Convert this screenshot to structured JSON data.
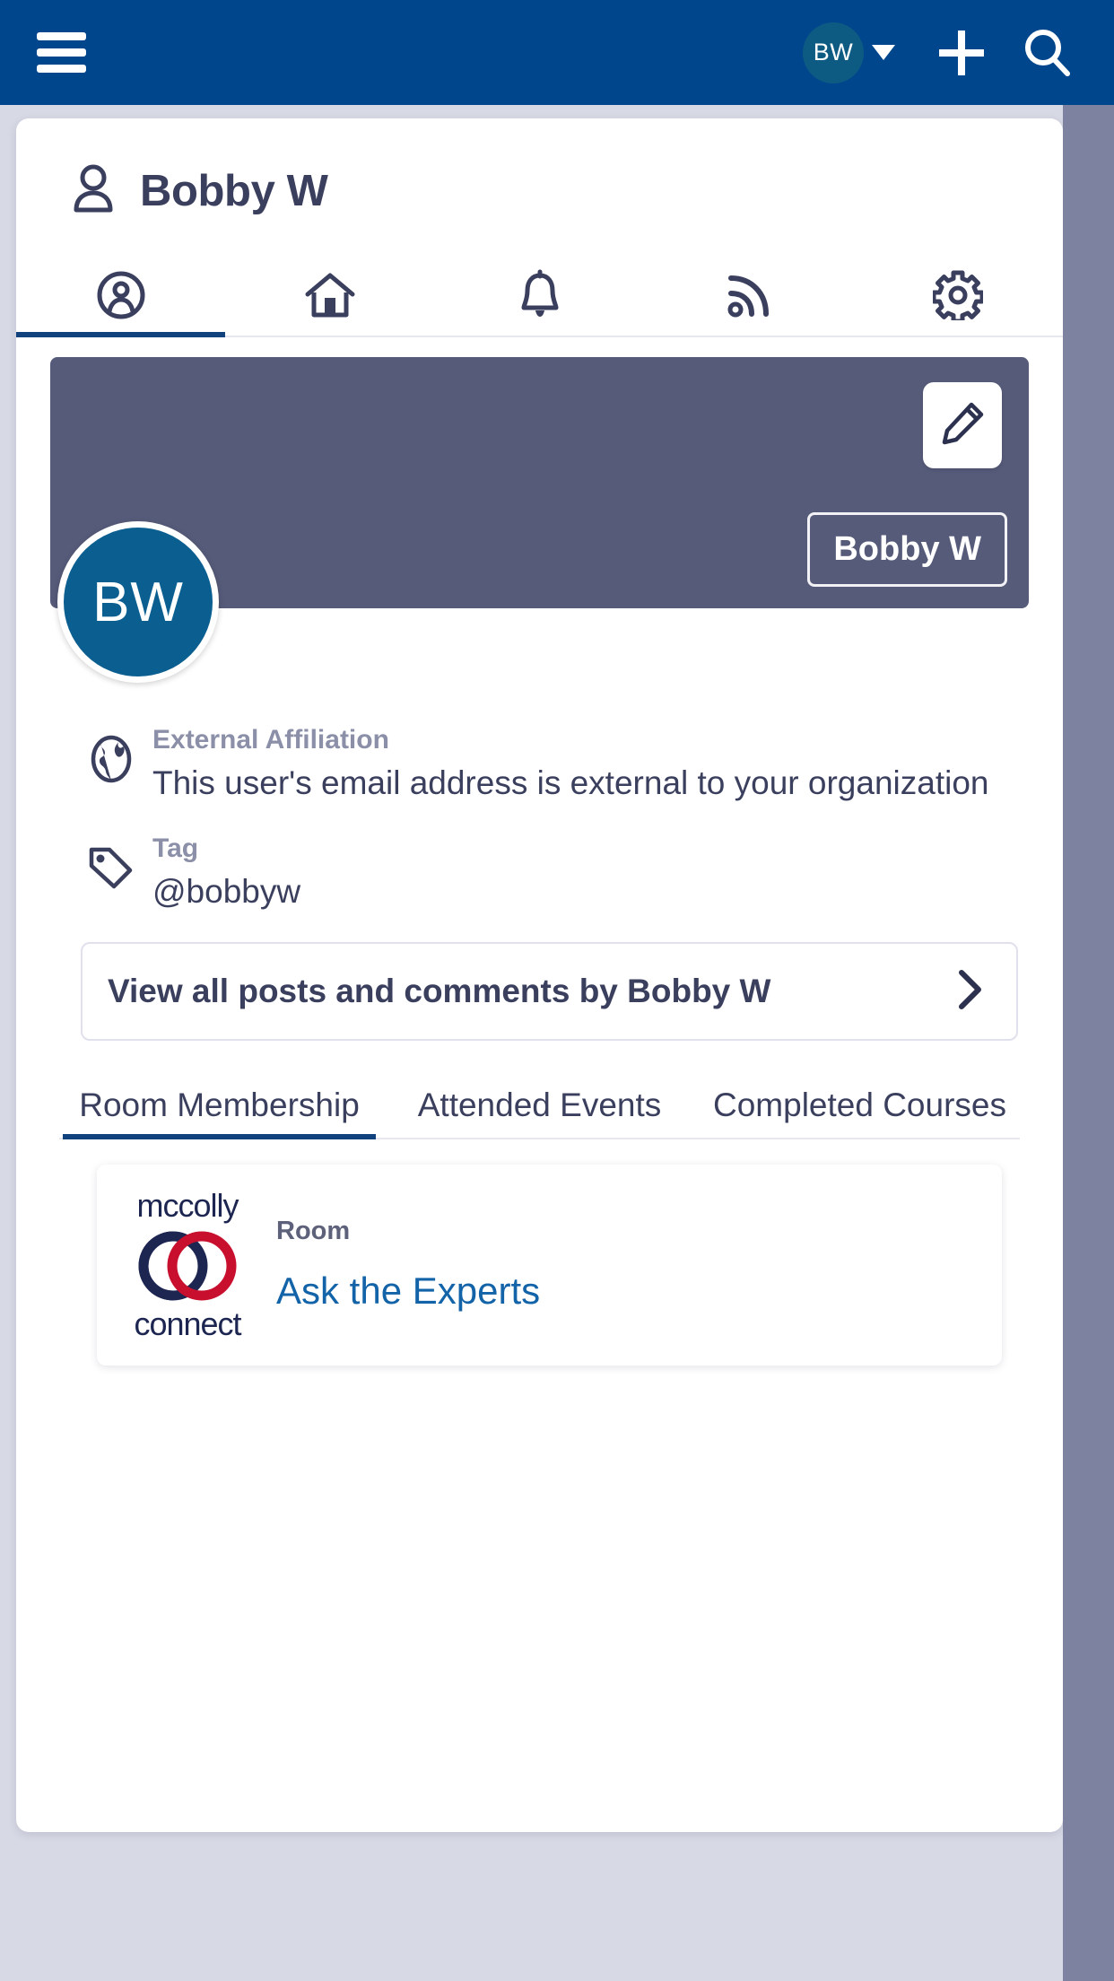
{
  "topbar": {
    "menu_icon": "hamburger-menu-icon",
    "avatar_initials": "BW",
    "caret_icon": "chevron-down-icon",
    "add_icon": "plus-icon",
    "search_icon": "search-icon",
    "background_color": "#00468c",
    "avatar_color": "#0d5b82"
  },
  "profile_card": {
    "header": {
      "icon": "person-icon",
      "title": "Bobby W"
    },
    "icon_tabs": [
      {
        "name": "profile",
        "icon": "person-circle-icon",
        "active": true
      },
      {
        "name": "home",
        "icon": "home-icon",
        "active": false
      },
      {
        "name": "notifications",
        "icon": "bell-icon",
        "active": false
      },
      {
        "name": "feed",
        "icon": "rss-icon",
        "active": false
      },
      {
        "name": "settings",
        "icon": "gear-icon",
        "active": false
      }
    ],
    "cover": {
      "background_color": "#565b7a",
      "edit_icon": "pencil-icon",
      "name_badge": "Bobby W",
      "avatar_initials": "BW",
      "avatar_color": "#0a5e90"
    },
    "info": [
      {
        "icon": "globe-icon",
        "label": "External Affiliation",
        "value": "This user's email address is external to your organization"
      },
      {
        "icon": "tag-icon",
        "label": "Tag",
        "value": "@bobbyw"
      }
    ],
    "view_all": {
      "label": "View all posts and comments by Bobby W",
      "chevron_icon": "chevron-right-icon"
    },
    "text_tabs": [
      {
        "label": "Room Membership",
        "active": true
      },
      {
        "label": "Attended Events",
        "active": false
      },
      {
        "label": "Completed Courses",
        "active": false
      }
    ],
    "rooms": [
      {
        "logo_top": "mccolly",
        "logo_bottom": "connect",
        "logo_icon": "mccolly-rings-logo",
        "kicker": "Room",
        "name": "Ask the Experts",
        "name_color": "#1263a8"
      }
    ]
  },
  "scrollbar": {
    "track_color": "#7c82a0"
  }
}
